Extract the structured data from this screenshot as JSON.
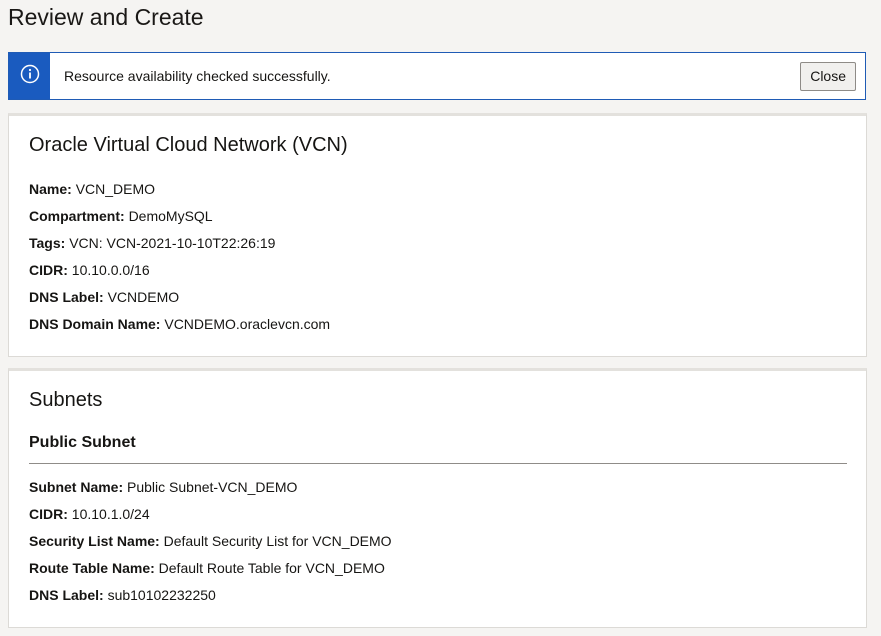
{
  "page": {
    "title": "Review and Create"
  },
  "banner": {
    "icon": "info-icon",
    "message": "Resource availability checked successfully.",
    "close_label": "Close",
    "accent": "#1a5bbf"
  },
  "vcn": {
    "heading": "Oracle Virtual Cloud Network (VCN)",
    "fields": [
      {
        "label": "Name:",
        "value": "VCN_DEMO"
      },
      {
        "label": "Compartment:",
        "value": "DemoMySQL"
      },
      {
        "label": "Tags:",
        "value": "VCN: VCN-2021-10-10T22:26:19"
      },
      {
        "label": "CIDR:",
        "value": "10.10.0.0/16"
      },
      {
        "label": "DNS Label:",
        "value": "VCNDEMO"
      },
      {
        "label": "DNS Domain Name:",
        "value": "VCNDEMO.oraclevcn.com"
      }
    ]
  },
  "subnets": {
    "heading": "Subnets",
    "subheading": "Public Subnet",
    "fields": [
      {
        "label": "Subnet Name:",
        "value": "Public Subnet-VCN_DEMO"
      },
      {
        "label": "CIDR:",
        "value": "10.10.1.0/24"
      },
      {
        "label": "Security List Name:",
        "value": "Default Security List for VCN_DEMO"
      },
      {
        "label": "Route Table Name:",
        "value": "Default Route Table for VCN_DEMO"
      },
      {
        "label": "DNS Label:",
        "value": "sub10102232250"
      }
    ]
  }
}
